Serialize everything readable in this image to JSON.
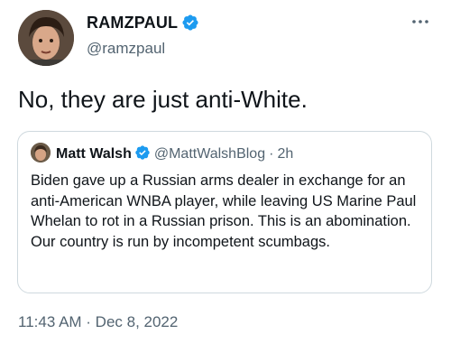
{
  "author": {
    "display_name": "RAMZPAUL",
    "handle": "@ramzpaul",
    "verified": true
  },
  "more_icon": "more-horizontal-icon",
  "tweet_text": "No, they are just anti-White.",
  "quoted_tweet": {
    "display_name": "Matt Walsh",
    "handle": "@MattWalshBlog",
    "separator": "·",
    "time": "2h",
    "verified": true,
    "text": "Biden gave up a Russian arms dealer in exchange for an anti-American WNBA player, while leaving US Marine Paul Whelan to rot in a Russian prison. This is an abomination. Our country is run by incompetent scumbags."
  },
  "timestamp": "11:43 AM · Dec 8, 2022",
  "colors": {
    "text": "#0f1419",
    "secondary": "#536471",
    "verified_blue": "#1d9bf0",
    "border": "#cfd9de"
  }
}
